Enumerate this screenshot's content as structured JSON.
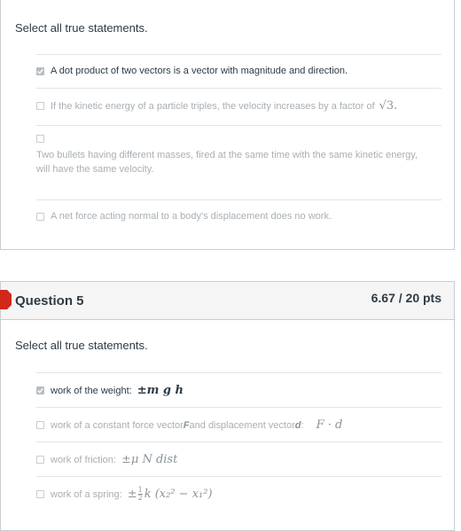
{
  "question4": {
    "prompt": "Select all true statements.",
    "options": [
      {
        "text": "A dot product of two vectors is a vector with magnitude and direction.",
        "checked": true
      },
      {
        "text": "If the kinetic energy of a particle triples, the velocity increases by a factor of",
        "math": "√3.",
        "checked": false
      },
      {
        "text_line1": "Two bullets having different masses, fired at the same time with the same kinetic energy,",
        "text_line2": "will have the same velocity.",
        "checked": false
      },
      {
        "text": "A net force acting normal to a body's displacement does no work.",
        "checked": false
      }
    ]
  },
  "question5": {
    "title": "Question 5",
    "points": "6.67 / 20 pts",
    "prompt": "Select all true statements.",
    "options": [
      {
        "text": "work of the weight:",
        "math": "±m g h",
        "checked": true
      },
      {
        "text_a": "work of a constant force vector ",
        "bold_a": "F",
        "text_b": " and displacement vector ",
        "bold_b": "d",
        "text_c": ":",
        "math": "F · d",
        "checked": false
      },
      {
        "text": "work of friction:",
        "math": "±μ N dist",
        "checked": false
      },
      {
        "text": "work of a spring:",
        "math_pre": "±",
        "frac_num": "1",
        "frac_den": "2",
        "math_post": "k (x₂² − x₁²)",
        "checked": false
      }
    ]
  }
}
